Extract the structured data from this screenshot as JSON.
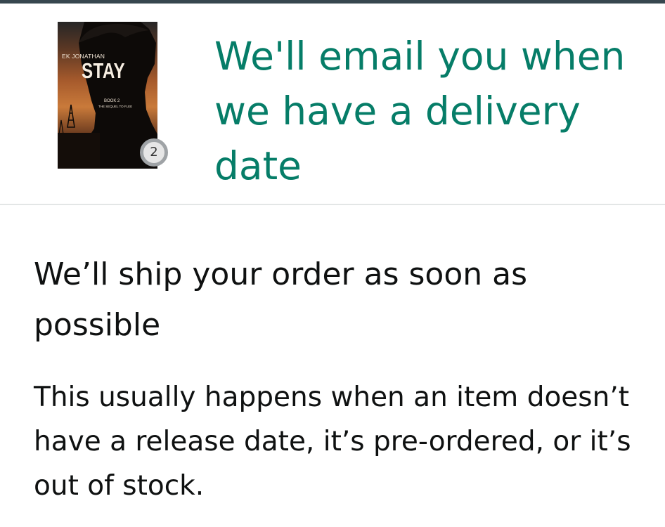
{
  "order": {
    "book": {
      "author": "EK JONATHAN",
      "title": "STAY",
      "book_number": "BOOK 2",
      "sequel_line": "THE SEQUEL TO FLEE"
    },
    "quantity": "2",
    "delivery_heading": "We'll email you when we have a delivery date"
  },
  "shipping": {
    "heading": "We’ll ship your order as soon as possible",
    "body": "This usually happens when an item doesn’t have a release date, it’s pre-ordered, or it’s out of stock."
  },
  "colors": {
    "accent": "#067d68",
    "text": "#0f1111",
    "top_bar": "#37474f",
    "divider": "#e3e6e6"
  }
}
